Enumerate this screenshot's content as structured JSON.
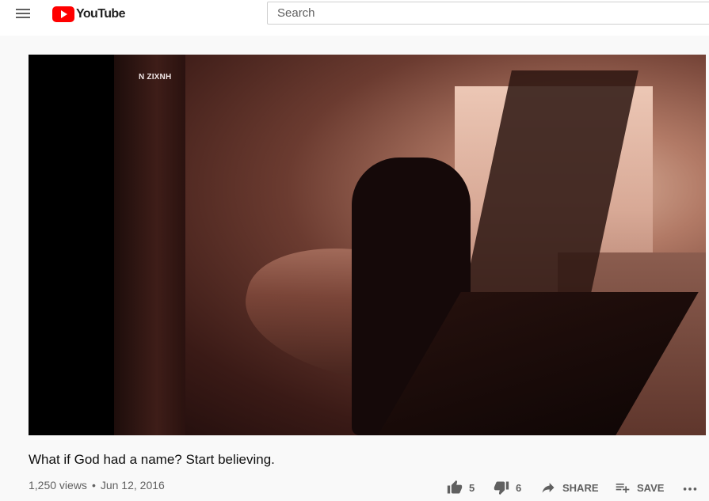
{
  "masthead": {
    "logo_text": "YouTube",
    "search_placeholder": "Search",
    "brand_red": "#ff0000",
    "icons": {
      "menu": "hamburger-menu-icon",
      "logo": "youtube-play-icon"
    }
  },
  "player": {
    "watermark": "N ZIXNH"
  },
  "video": {
    "title": "What if God had a name? Start believing.",
    "views": "1,250 views",
    "separator": "•",
    "date": "Jun 12, 2016"
  },
  "actions": {
    "like_count": "5",
    "dislike_count": "6",
    "share_label": "SHARE",
    "save_label": "SAVE",
    "icons": {
      "like": "thumbs-up-icon",
      "dislike": "thumbs-down-icon",
      "share": "share-arrow-icon",
      "save": "playlist-add-icon",
      "more": "more-horizontal-icon"
    }
  }
}
